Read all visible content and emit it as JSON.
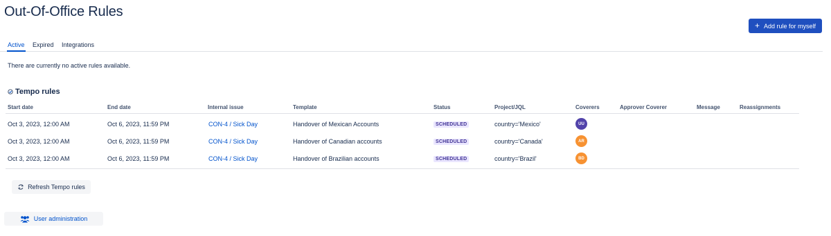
{
  "header": {
    "title": "Out-Of-Office Rules",
    "add_button_label": "Add rule for myself"
  },
  "tabs": [
    {
      "label": "Active"
    },
    {
      "label": "Expired"
    },
    {
      "label": "Integrations"
    }
  ],
  "active": {
    "empty_message": "There are currently no active rules available."
  },
  "tempo": {
    "title": "Tempo rules",
    "columns": [
      "Start date",
      "End date",
      "Internal issue",
      "Template",
      "Status",
      "Project/JQL",
      "Coverers",
      "Approver Coverer",
      "Message",
      "Reassignments"
    ],
    "rows": [
      {
        "start": "Oct 3, 2023, 12:00 AM",
        "end": "Oct 6, 2023, 11:59 PM",
        "issue": "CON-4 / Sick Day",
        "template": "Handover of Mexican Accounts",
        "status": "SCHEDULED",
        "jql": "country='Mexico'",
        "coverer": "UU",
        "coverer_color": "#5243aa"
      },
      {
        "start": "Oct 3, 2023, 12:00 AM",
        "end": "Oct 6, 2023, 11:59 PM",
        "issue": "CON-4 / Sick Day",
        "template": "Handover of Canadian accounts",
        "status": "SCHEDULED",
        "jql": "country='Canada'",
        "coverer": "AR",
        "coverer_color": "#f79232"
      },
      {
        "start": "Oct 3, 2023, 12:00 AM",
        "end": "Oct 6, 2023, 11:59 PM",
        "issue": "CON-4 / Sick Day",
        "template": "Handover of Brazilian accounts",
        "status": "SCHEDULED",
        "jql": "country='Brazil'",
        "coverer": "BD",
        "coverer_color": "#f79232"
      }
    ],
    "refresh_label": "Refresh Tempo rules"
  },
  "footer": {
    "admin_label": "User administration"
  },
  "colors": {
    "primary": "#1f4fbf",
    "link": "#0052cc",
    "lozenge_bg": "#eae6ff",
    "lozenge_text": "#403294"
  }
}
